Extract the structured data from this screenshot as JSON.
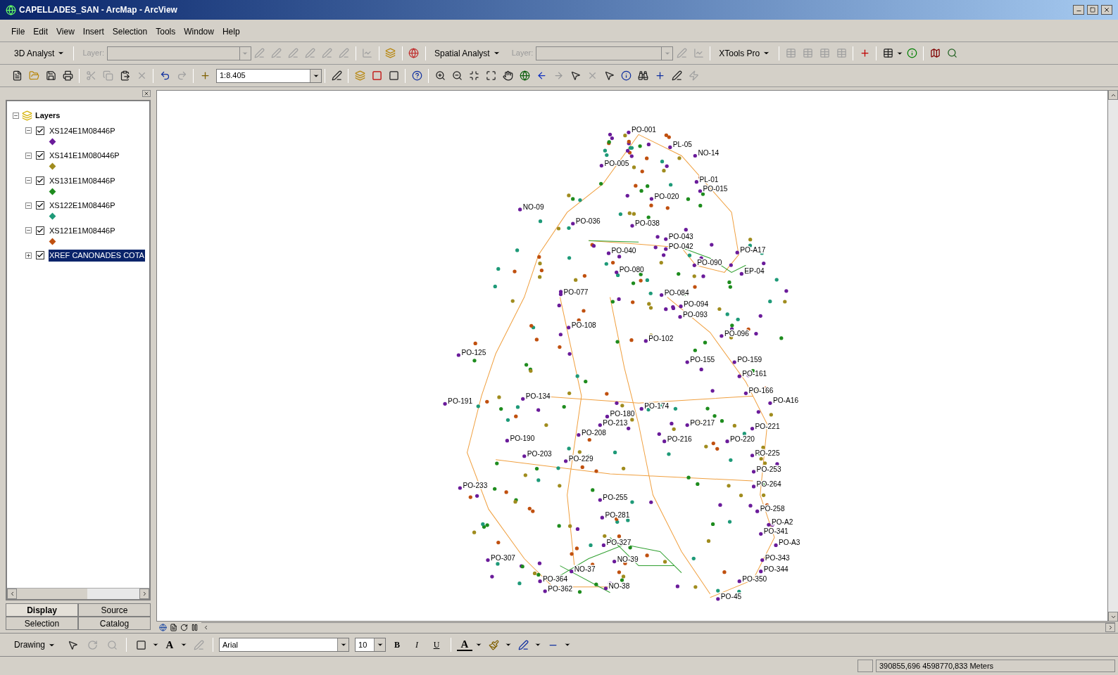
{
  "window": {
    "title": "CAPELLADES_SAN - ArcMap - ArcView"
  },
  "menu": [
    {
      "label": "File"
    },
    {
      "label": "Edit"
    },
    {
      "label": "View"
    },
    {
      "label": "Insert"
    },
    {
      "label": "Selection"
    },
    {
      "label": "Tools"
    },
    {
      "label": "Window"
    },
    {
      "label": "Help"
    }
  ],
  "toolbars": {
    "analyst_3d": {
      "label": "3D Analyst",
      "layer_label": "Layer:"
    },
    "spatial_analyst": {
      "label": "Spatial Analyst",
      "layer_label": "Layer:"
    },
    "xtools": {
      "label": "XTools Pro"
    },
    "standard": {
      "scale": "1:8.405"
    }
  },
  "toc": {
    "root": {
      "label": "Layers",
      "expanded": true
    },
    "layers": [
      {
        "name": "XS124E1M08446P",
        "checked": true,
        "expanded": true,
        "selected": false,
        "color": "#6a1b9a"
      },
      {
        "name": "XS141E1M080446P",
        "checked": true,
        "expanded": true,
        "selected": false,
        "color": "#a08c1e"
      },
      {
        "name": "XS131E1M08446P",
        "checked": true,
        "expanded": true,
        "selected": false,
        "color": "#1e8c1e"
      },
      {
        "name": "XS122E1M08446P",
        "checked": true,
        "expanded": true,
        "selected": false,
        "color": "#1e9a78"
      },
      {
        "name": "XS121E1M08446P",
        "checked": true,
        "expanded": true,
        "selected": false,
        "color": "#c0500f"
      },
      {
        "name": "XREF CANONADES COTA",
        "checked": true,
        "expanded": false,
        "selected": true
      }
    ],
    "tabs": [
      {
        "label": "Display",
        "selected": true
      },
      {
        "label": "Source",
        "selected": false
      },
      {
        "label": "Selection",
        "selected": false
      },
      {
        "label": "Catalog",
        "selected": false
      }
    ]
  },
  "map": {
    "labels": [
      "PO-001",
      "NO-14",
      "PO-005",
      "PL-05",
      "PL-01",
      "PO-015",
      "PO-020",
      "NO-09",
      "PO-036",
      "PO-038",
      "PO-043",
      "PO-042",
      "PO-A17",
      "PO-040",
      "PO-080",
      "PO-090",
      "EP-04",
      "PO-077",
      "PO-084",
      "PO-094",
      "PO-093",
      "PO-108",
      "PO-096",
      "PO-102",
      "PO-155",
      "PO-159",
      "PO-161",
      "PO-134",
      "PO-166",
      "PO-A16",
      "PO-174",
      "PO-180",
      "PO-217",
      "PO-221",
      "PO-213",
      "PO-208",
      "PO-190",
      "PO-216",
      "PO-220",
      "PO-225",
      "PO-229",
      "PO-203",
      "PO-253",
      "PO-264",
      "PO-255",
      "PO-281",
      "PO-258",
      "PO-A2",
      "PO-341",
      "PO-A3",
      "PO-343",
      "PO-344",
      "PO-350",
      "NO-37",
      "NO-38",
      "PO-45",
      "PO-364",
      "PO-362",
      "PO-307",
      "PO-233",
      "PO-191",
      "PO-125",
      "PO-327",
      "NO-39"
    ]
  },
  "drawing": {
    "label": "Drawing",
    "text_tool": "A",
    "font": "Arial",
    "size": "10",
    "bold": "B",
    "italic": "I",
    "underline": "U",
    "font_color": "A"
  },
  "status_bar": {
    "coordinates": "390855,696  4598770,833 Meters"
  }
}
